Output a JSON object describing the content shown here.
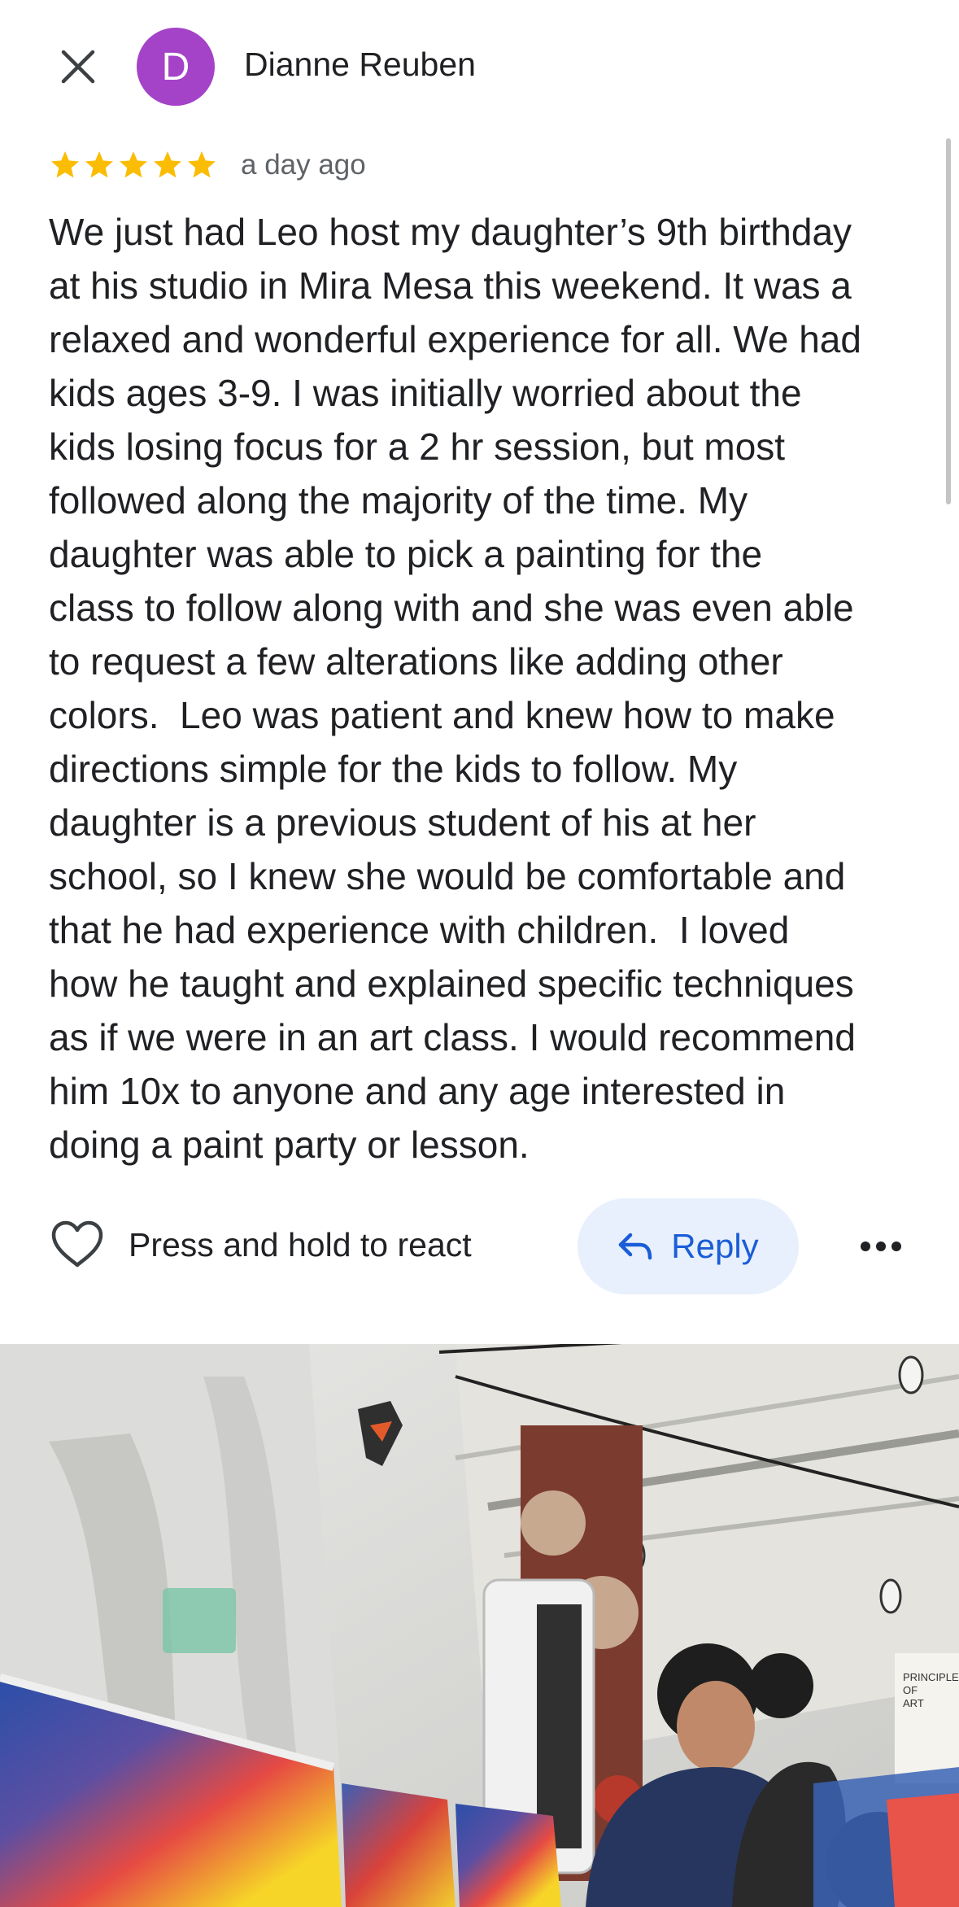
{
  "header": {
    "close_icon": "close-icon",
    "avatar_letter": "D",
    "avatar_color": "#a442c8",
    "author_name": "Dianne Reuben"
  },
  "review": {
    "rating": 5,
    "max_rating": 5,
    "star_color": "#fbbc04",
    "time_ago": "a day ago",
    "text_lines": [
      "We just had Leo host my daughter’s 9th birthday",
      "at his studio in Mira Mesa this weekend. It was a",
      "relaxed and wonderful experience for all. We had",
      "kids ages 3-9. I was initially worried about the",
      "kids losing focus for a 2 hr session, but most",
      "followed along the majority of the time. My",
      "daughter was able to pick a painting for the",
      "class to follow along with and she was even able",
      "to request a few alterations like adding other",
      "colors.  Leo was patient and knew how to make",
      "directions simple for the kids to follow. My",
      "daughter is a previous student of his at her",
      "school, so I knew she would be comfortable and",
      "that he had experience with children.  I loved",
      "how he taught and explained specific techniques",
      "as if we were in an art class. I would recommend",
      "him 10x to anyone and any age interested in",
      "doing a paint party or lesson."
    ]
  },
  "actions": {
    "react_icon": "heart-outline-icon",
    "react_label": "Press and hold to react",
    "reply_icon": "reply-arrow-icon",
    "reply_label": "Reply",
    "reply_color": "#1a5dd6",
    "more_icon": "more-horizontal-icon"
  },
  "photo": {
    "subject": "review-photo",
    "board_text": "PRINCIPLES OF ART"
  }
}
